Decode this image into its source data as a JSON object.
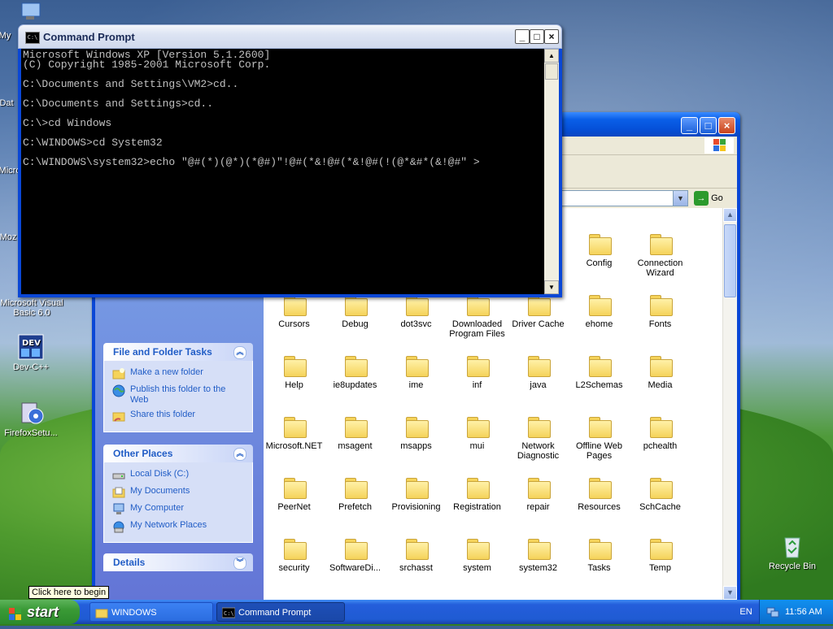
{
  "desktop": {
    "icons": [
      {
        "label": "My Network Places"
      },
      {
        "label": "Data"
      },
      {
        "label": "Microsoft Office"
      },
      {
        "label": "Mozilla Firefox"
      },
      {
        "label": "Microsoft Visual Basic 6.0"
      },
      {
        "label": "Dev-C++"
      },
      {
        "label": "FirefoxSetu..."
      },
      {
        "label": "Recycle Bin"
      }
    ],
    "partial_labels": [
      "My",
      "Dat",
      "Micro",
      "Moz"
    ]
  },
  "explorer": {
    "title": "WINDOWS",
    "go_label": "Go",
    "panels": {
      "file_folder_tasks": {
        "title": "File and Folder Tasks",
        "items": [
          "Make a new folder",
          "Publish this folder to the Web",
          "Share this folder"
        ]
      },
      "other_places": {
        "title": "Other Places",
        "items": [
          "Local Disk (C:)",
          "My Documents",
          "My Computer",
          "My Network Places"
        ]
      },
      "details": {
        "title": "Details"
      }
    },
    "folders_row0": [
      "Config",
      "Connection Wizard"
    ],
    "folders": [
      [
        "Cursors",
        "Debug",
        "dot3svc",
        "Downloaded Program Files",
        "Driver Cache",
        "ehome",
        "Fonts"
      ],
      [
        "Help",
        "ie8updates",
        "ime",
        "inf",
        "java",
        "L2Schemas",
        "Media"
      ],
      [
        "Microsoft.NET",
        "msagent",
        "msapps",
        "mui",
        "Network Diagnostic",
        "Offline Web Pages",
        "pchealth"
      ],
      [
        "PeerNet",
        "Prefetch",
        "Provisioning",
        "Registration",
        "repair",
        "Resources",
        "SchCache"
      ],
      [
        "security",
        "SoftwareDi...",
        "srchasst",
        "system",
        "system32",
        "Tasks",
        "Temp"
      ]
    ]
  },
  "cmd": {
    "title": "Command Prompt",
    "icon_text": "C:\\",
    "lines": [
      "Microsoft Windows XP [Version 5.1.2600]",
      "(C) Copyright 1985-2001 Microsoft Corp.",
      "",
      "C:\\Documents and Settings\\VM2>cd..",
      "",
      "C:\\Documents and Settings>cd..",
      "",
      "C:\\>cd Windows",
      "",
      "C:\\WINDOWS>cd System32",
      "",
      "C:\\WINDOWS\\system32>echo \"@#(*)(@*)(*@#)\"!@#(*&!@#(*&!@#(!(@*&#*(&!@#\" >"
    ]
  },
  "taskbar": {
    "start_label": "start",
    "tooltip": "Click here to begin",
    "buttons": [
      {
        "label": "WINDOWS",
        "state": "inactive"
      },
      {
        "label": "Command Prompt",
        "state": "active"
      }
    ],
    "language": "EN",
    "clock": "11:56 AM"
  },
  "colors": {
    "taskbar_blue": "#245edb",
    "start_green": "#3a9a36",
    "link_blue": "#215dc6",
    "console_bg": "#000000",
    "console_text": "#c0c0c0"
  }
}
